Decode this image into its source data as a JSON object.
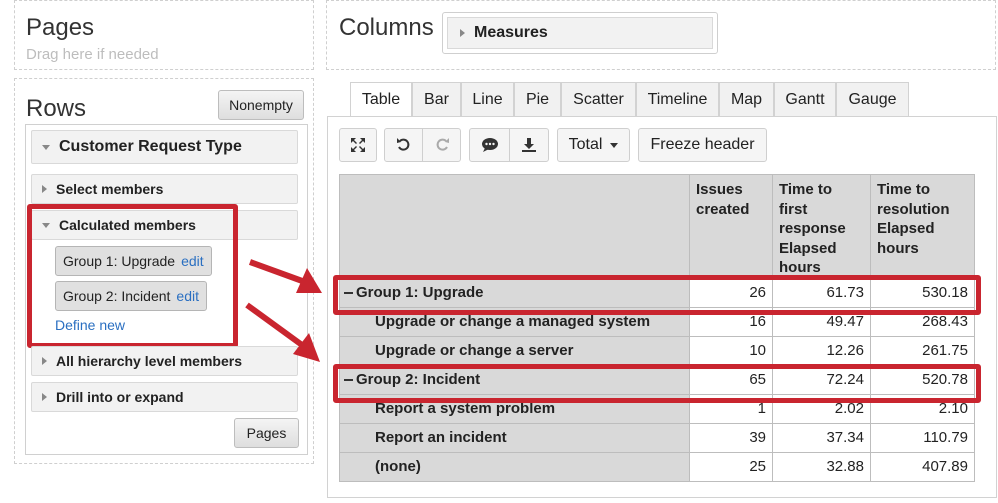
{
  "pages": {
    "title": "Pages",
    "hint": "Drag here if needed"
  },
  "columns": {
    "title": "Columns",
    "measures_label": "Measures"
  },
  "rows": {
    "title": "Rows",
    "nonempty_label": "Nonempty",
    "dimension": "Customer Request Type",
    "select_members": "Select members",
    "calculated_members": "Calculated members",
    "calc_items": [
      {
        "label": "Group 1: Upgrade",
        "edit": "edit"
      },
      {
        "label": "Group 2: Incident",
        "edit": "edit"
      }
    ],
    "define_new": "Define new",
    "all_hierarchy": "All hierarchy level members",
    "drill": "Drill into or expand",
    "pages_button": "Pages"
  },
  "tabs": [
    "Table",
    "Bar",
    "Line",
    "Pie",
    "Scatter",
    "Timeline",
    "Map",
    "Gantt",
    "Gauge"
  ],
  "active_tab": "Table",
  "toolbar": {
    "total_label": "Total",
    "freeze_label": "Freeze header"
  },
  "table": {
    "headers": [
      [
        "Issues",
        "created"
      ],
      [
        "Time to",
        "first",
        "response",
        "Elapsed",
        "hours"
      ],
      [
        "Time to",
        "resolution",
        "Elapsed",
        "hours"
      ]
    ],
    "rows": [
      {
        "label": "Group 1: Upgrade",
        "group": true,
        "values": [
          "26",
          "61.73",
          "530.18"
        ]
      },
      {
        "label": "Upgrade or change a managed system",
        "group": false,
        "values": [
          "16",
          "49.47",
          "268.43"
        ]
      },
      {
        "label": "Upgrade or change a server",
        "group": false,
        "values": [
          "10",
          "12.26",
          "261.75"
        ]
      },
      {
        "label": "Group 2: Incident",
        "group": true,
        "values": [
          "65",
          "72.24",
          "520.78"
        ]
      },
      {
        "label": "Report a system problem",
        "group": false,
        "values": [
          "1",
          "2.02",
          "2.10"
        ]
      },
      {
        "label": "Report an incident",
        "group": false,
        "values": [
          "39",
          "37.34",
          "110.79"
        ]
      },
      {
        "label": "(none)",
        "group": false,
        "values": [
          "25",
          "32.88",
          "407.89"
        ]
      }
    ]
  },
  "colors": {
    "highlight": "#c9252f",
    "link": "#2a6fc1"
  }
}
